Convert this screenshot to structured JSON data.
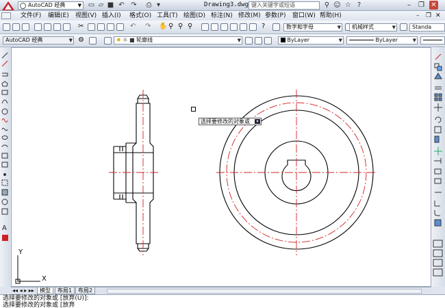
{
  "titlebar": {
    "workspace": "AutoCAD 经典",
    "document_title": "Drawing3.dwg",
    "search_placeholder": "键入关键字或短语"
  },
  "menus": [
    {
      "label": "文件(F)"
    },
    {
      "label": "编辑(E)"
    },
    {
      "label": "视图(V)"
    },
    {
      "label": "插入(I)"
    },
    {
      "label": "格式(O)"
    },
    {
      "label": "工具(T)"
    },
    {
      "label": "绘图(D)"
    },
    {
      "label": "标注(N)"
    },
    {
      "label": "修改(M)"
    },
    {
      "label": "参数(P)"
    },
    {
      "label": "窗口(W)"
    },
    {
      "label": "帮助(H)"
    }
  ],
  "toolbar": {
    "text_style": "数字和字母",
    "dim_style": "机械样式",
    "table_style": "Standa",
    "workspace_combo": "AutoCAD 经典",
    "layer": "轮廓线",
    "color": "ByLayer",
    "linetype": "ByLayer"
  },
  "canvas": {
    "tooltip": "选择要修改的对象或",
    "ucs_x": "X",
    "ucs_y": "Y"
  },
  "tabs": [
    {
      "label": "模型"
    },
    {
      "label": "布局1"
    },
    {
      "label": "布局2"
    }
  ],
  "command": {
    "line1": "选择要修改的对象或 [放弃(U)]:",
    "line2": "选择要修改的对象或 [放弃"
  },
  "colors": {
    "outline": "#000000",
    "centerline": "#d42020",
    "canvas_bg": "#ffffff"
  }
}
